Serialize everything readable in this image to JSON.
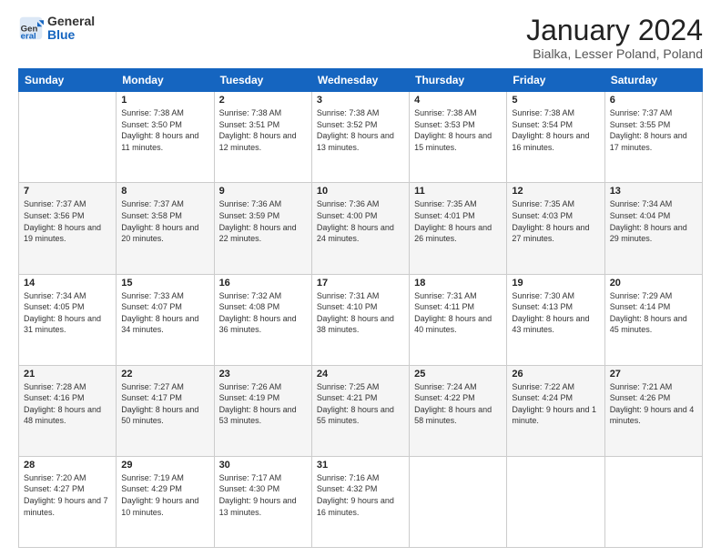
{
  "logo": {
    "general": "General",
    "blue": "Blue"
  },
  "title": {
    "month": "January 2024",
    "location": "Bialka, Lesser Poland, Poland"
  },
  "days": [
    "Sunday",
    "Monday",
    "Tuesday",
    "Wednesday",
    "Thursday",
    "Friday",
    "Saturday"
  ],
  "weeks": [
    [
      {
        "date": "",
        "sunrise": "",
        "sunset": "",
        "daylight": ""
      },
      {
        "date": "1",
        "sunrise": "Sunrise: 7:38 AM",
        "sunset": "Sunset: 3:50 PM",
        "daylight": "Daylight: 8 hours and 11 minutes."
      },
      {
        "date": "2",
        "sunrise": "Sunrise: 7:38 AM",
        "sunset": "Sunset: 3:51 PM",
        "daylight": "Daylight: 8 hours and 12 minutes."
      },
      {
        "date": "3",
        "sunrise": "Sunrise: 7:38 AM",
        "sunset": "Sunset: 3:52 PM",
        "daylight": "Daylight: 8 hours and 13 minutes."
      },
      {
        "date": "4",
        "sunrise": "Sunrise: 7:38 AM",
        "sunset": "Sunset: 3:53 PM",
        "daylight": "Daylight: 8 hours and 15 minutes."
      },
      {
        "date": "5",
        "sunrise": "Sunrise: 7:38 AM",
        "sunset": "Sunset: 3:54 PM",
        "daylight": "Daylight: 8 hours and 16 minutes."
      },
      {
        "date": "6",
        "sunrise": "Sunrise: 7:37 AM",
        "sunset": "Sunset: 3:55 PM",
        "daylight": "Daylight: 8 hours and 17 minutes."
      }
    ],
    [
      {
        "date": "7",
        "sunrise": "Sunrise: 7:37 AM",
        "sunset": "Sunset: 3:56 PM",
        "daylight": "Daylight: 8 hours and 19 minutes."
      },
      {
        "date": "8",
        "sunrise": "Sunrise: 7:37 AM",
        "sunset": "Sunset: 3:58 PM",
        "daylight": "Daylight: 8 hours and 20 minutes."
      },
      {
        "date": "9",
        "sunrise": "Sunrise: 7:36 AM",
        "sunset": "Sunset: 3:59 PM",
        "daylight": "Daylight: 8 hours and 22 minutes."
      },
      {
        "date": "10",
        "sunrise": "Sunrise: 7:36 AM",
        "sunset": "Sunset: 4:00 PM",
        "daylight": "Daylight: 8 hours and 24 minutes."
      },
      {
        "date": "11",
        "sunrise": "Sunrise: 7:35 AM",
        "sunset": "Sunset: 4:01 PM",
        "daylight": "Daylight: 8 hours and 26 minutes."
      },
      {
        "date": "12",
        "sunrise": "Sunrise: 7:35 AM",
        "sunset": "Sunset: 4:03 PM",
        "daylight": "Daylight: 8 hours and 27 minutes."
      },
      {
        "date": "13",
        "sunrise": "Sunrise: 7:34 AM",
        "sunset": "Sunset: 4:04 PM",
        "daylight": "Daylight: 8 hours and 29 minutes."
      }
    ],
    [
      {
        "date": "14",
        "sunrise": "Sunrise: 7:34 AM",
        "sunset": "Sunset: 4:05 PM",
        "daylight": "Daylight: 8 hours and 31 minutes."
      },
      {
        "date": "15",
        "sunrise": "Sunrise: 7:33 AM",
        "sunset": "Sunset: 4:07 PM",
        "daylight": "Daylight: 8 hours and 34 minutes."
      },
      {
        "date": "16",
        "sunrise": "Sunrise: 7:32 AM",
        "sunset": "Sunset: 4:08 PM",
        "daylight": "Daylight: 8 hours and 36 minutes."
      },
      {
        "date": "17",
        "sunrise": "Sunrise: 7:31 AM",
        "sunset": "Sunset: 4:10 PM",
        "daylight": "Daylight: 8 hours and 38 minutes."
      },
      {
        "date": "18",
        "sunrise": "Sunrise: 7:31 AM",
        "sunset": "Sunset: 4:11 PM",
        "daylight": "Daylight: 8 hours and 40 minutes."
      },
      {
        "date": "19",
        "sunrise": "Sunrise: 7:30 AM",
        "sunset": "Sunset: 4:13 PM",
        "daylight": "Daylight: 8 hours and 43 minutes."
      },
      {
        "date": "20",
        "sunrise": "Sunrise: 7:29 AM",
        "sunset": "Sunset: 4:14 PM",
        "daylight": "Daylight: 8 hours and 45 minutes."
      }
    ],
    [
      {
        "date": "21",
        "sunrise": "Sunrise: 7:28 AM",
        "sunset": "Sunset: 4:16 PM",
        "daylight": "Daylight: 8 hours and 48 minutes."
      },
      {
        "date": "22",
        "sunrise": "Sunrise: 7:27 AM",
        "sunset": "Sunset: 4:17 PM",
        "daylight": "Daylight: 8 hours and 50 minutes."
      },
      {
        "date": "23",
        "sunrise": "Sunrise: 7:26 AM",
        "sunset": "Sunset: 4:19 PM",
        "daylight": "Daylight: 8 hours and 53 minutes."
      },
      {
        "date": "24",
        "sunrise": "Sunrise: 7:25 AM",
        "sunset": "Sunset: 4:21 PM",
        "daylight": "Daylight: 8 hours and 55 minutes."
      },
      {
        "date": "25",
        "sunrise": "Sunrise: 7:24 AM",
        "sunset": "Sunset: 4:22 PM",
        "daylight": "Daylight: 8 hours and 58 minutes."
      },
      {
        "date": "26",
        "sunrise": "Sunrise: 7:22 AM",
        "sunset": "Sunset: 4:24 PM",
        "daylight": "Daylight: 9 hours and 1 minute."
      },
      {
        "date": "27",
        "sunrise": "Sunrise: 7:21 AM",
        "sunset": "Sunset: 4:26 PM",
        "daylight": "Daylight: 9 hours and 4 minutes."
      }
    ],
    [
      {
        "date": "28",
        "sunrise": "Sunrise: 7:20 AM",
        "sunset": "Sunset: 4:27 PM",
        "daylight": "Daylight: 9 hours and 7 minutes."
      },
      {
        "date": "29",
        "sunrise": "Sunrise: 7:19 AM",
        "sunset": "Sunset: 4:29 PM",
        "daylight": "Daylight: 9 hours and 10 minutes."
      },
      {
        "date": "30",
        "sunrise": "Sunrise: 7:17 AM",
        "sunset": "Sunset: 4:30 PM",
        "daylight": "Daylight: 9 hours and 13 minutes."
      },
      {
        "date": "31",
        "sunrise": "Sunrise: 7:16 AM",
        "sunset": "Sunset: 4:32 PM",
        "daylight": "Daylight: 9 hours and 16 minutes."
      },
      {
        "date": "",
        "sunrise": "",
        "sunset": "",
        "daylight": ""
      },
      {
        "date": "",
        "sunrise": "",
        "sunset": "",
        "daylight": ""
      },
      {
        "date": "",
        "sunrise": "",
        "sunset": "",
        "daylight": ""
      }
    ]
  ]
}
